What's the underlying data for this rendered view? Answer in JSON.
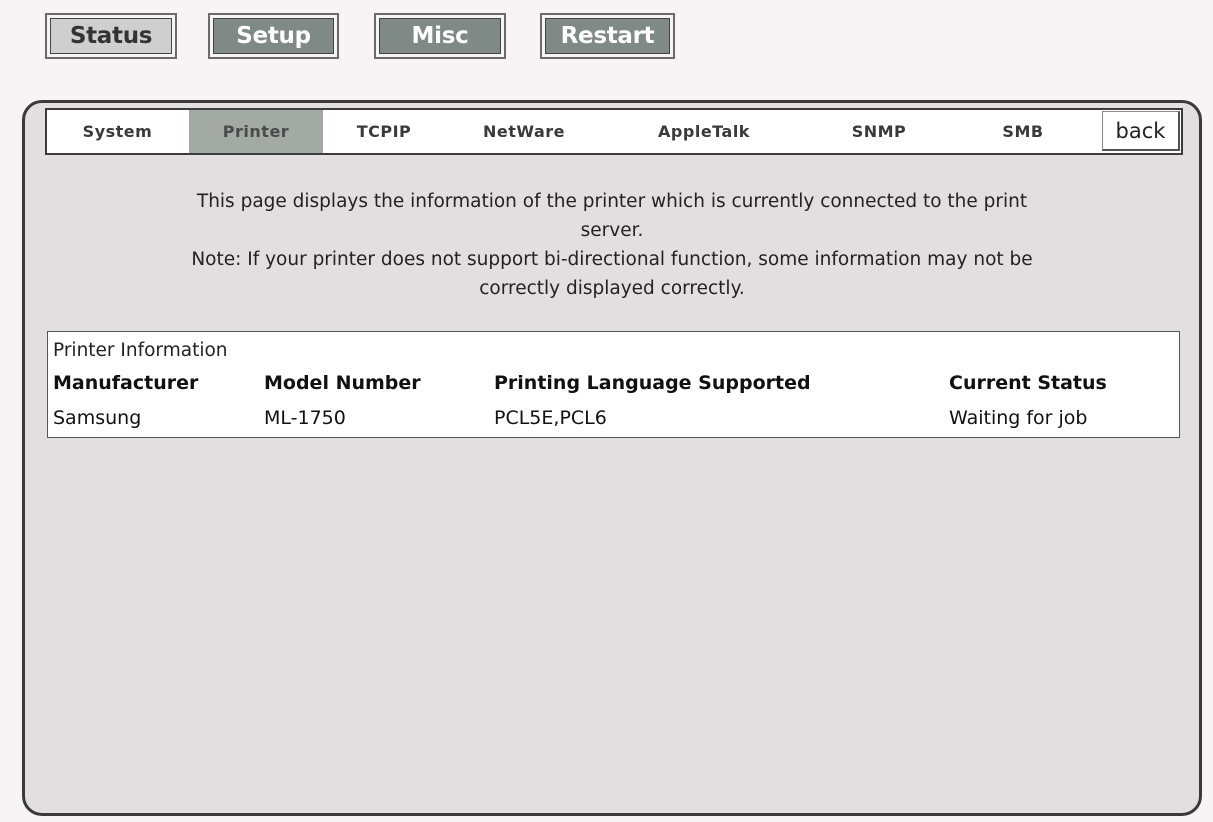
{
  "top_nav": {
    "status": "Status",
    "setup": "Setup",
    "misc": "Misc",
    "restart": "Restart"
  },
  "tabs": {
    "system": "System",
    "printer": "Printer",
    "tcpip": "TCPIP",
    "netware": "NetWare",
    "appletalk": "AppleTalk",
    "snmp": "SNMP",
    "smb": "SMB",
    "back": "back"
  },
  "description": {
    "line1": "This page displays the information of the printer which is currently connected to the print",
    "line2": "server.",
    "line3": "Note: If your printer does not support bi-directional function, some information may not be",
    "line4": "correctly displayed correctly."
  },
  "printer_info": {
    "caption": "Printer Information",
    "headers": {
      "manufacturer": "Manufacturer",
      "model": "Model Number",
      "language": "Printing Language Supported",
      "status": "Current Status"
    },
    "row": {
      "manufacturer": "Samsung",
      "model": "ML-1750",
      "language": "PCL5E,PCL6",
      "status": "Waiting for job"
    }
  }
}
